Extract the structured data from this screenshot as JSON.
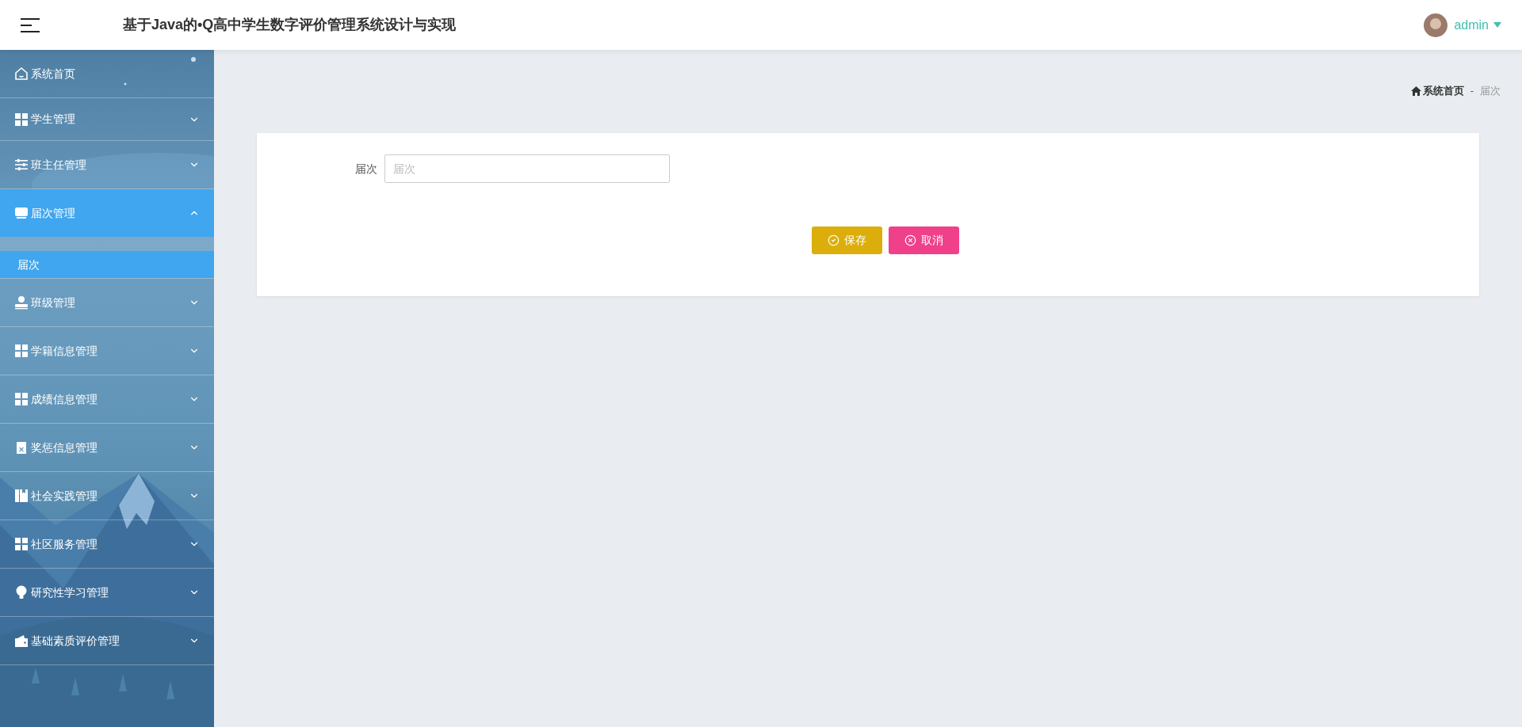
{
  "header": {
    "title": "基于Java的•Q高中学生数字评价管理系统设计与实现",
    "user": "admin"
  },
  "sidebar": {
    "items": [
      {
        "label": "系统首页",
        "selected": false
      },
      {
        "label": "学生管理",
        "expanded": false,
        "selected": false
      },
      {
        "label": "班主任管理",
        "expanded": false,
        "selected": false
      },
      {
        "label": "届次管理",
        "expanded": true,
        "selected": true,
        "children": [
          {
            "label": "届次",
            "selected": true
          }
        ]
      },
      {
        "label": "班级管理",
        "expanded": false,
        "selected": false
      },
      {
        "label": "学籍信息管理",
        "expanded": false,
        "selected": false
      },
      {
        "label": "成绩信息管理",
        "expanded": false,
        "selected": false
      },
      {
        "label": "奖惩信息管理",
        "expanded": false,
        "selected": false
      },
      {
        "label": "社会实践管理",
        "expanded": false,
        "selected": false
      },
      {
        "label": "社区服务管理",
        "expanded": false,
        "selected": false
      },
      {
        "label": "研究性学习管理",
        "expanded": false,
        "selected": false
      },
      {
        "label": "基础素质评价管理",
        "expanded": false,
        "selected": false
      }
    ]
  },
  "breadcrumb": [
    "系统首页",
    "-",
    "届次"
  ],
  "form": {
    "fields": [
      {
        "label": "届次",
        "placeholder": "届次"
      }
    ],
    "buttons": [
      {
        "kind": "save",
        "label": "保存"
      },
      {
        "kind": "cancel",
        "label": "取消"
      }
    ]
  }
}
